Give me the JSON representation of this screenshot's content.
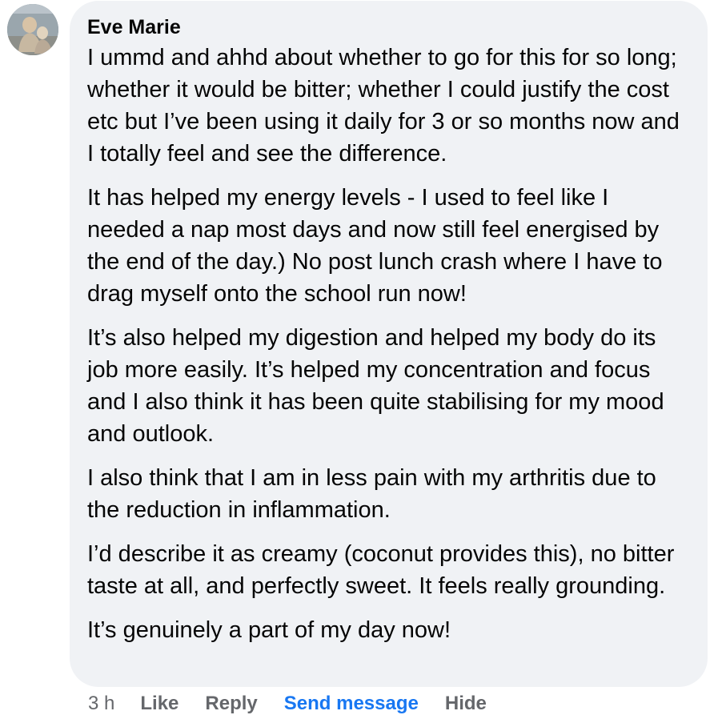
{
  "comment": {
    "author": "Eve Marie",
    "paragraphs": [
      "I ummd and ahhd about whether to go for this for so long; whether it would be bitter; whether I could justify the cost etc but I’ve been using it daily for 3 or so months now and I totally feel and see the difference.",
      "It has helped my energy levels - I used to feel like I needed a nap most days and now still feel energised by the end of the day.) No post lunch crash where I have to drag myself onto the school run now!",
      "It’s also helped my digestion and helped my body do its job more easily. It’s helped my concentration and focus and I also think it has been quite stabilising for my mood and outlook.",
      "I also think that I am in less pain with my arthritis due to the reduction in inflammation.",
      "I’d describe it as creamy (coconut provides this), no bitter taste at all, and perfectly sweet. It feels really grounding.",
      "It’s genuinely a part of my day now!"
    ]
  },
  "actions": {
    "timestamp": "3 h",
    "like": "Like",
    "reply": "Reply",
    "send_message": "Send message",
    "hide": "Hide"
  },
  "colors": {
    "bubble": "#f0f2f5",
    "text": "#050505",
    "muted": "#65676b",
    "link": "#1877f2"
  }
}
